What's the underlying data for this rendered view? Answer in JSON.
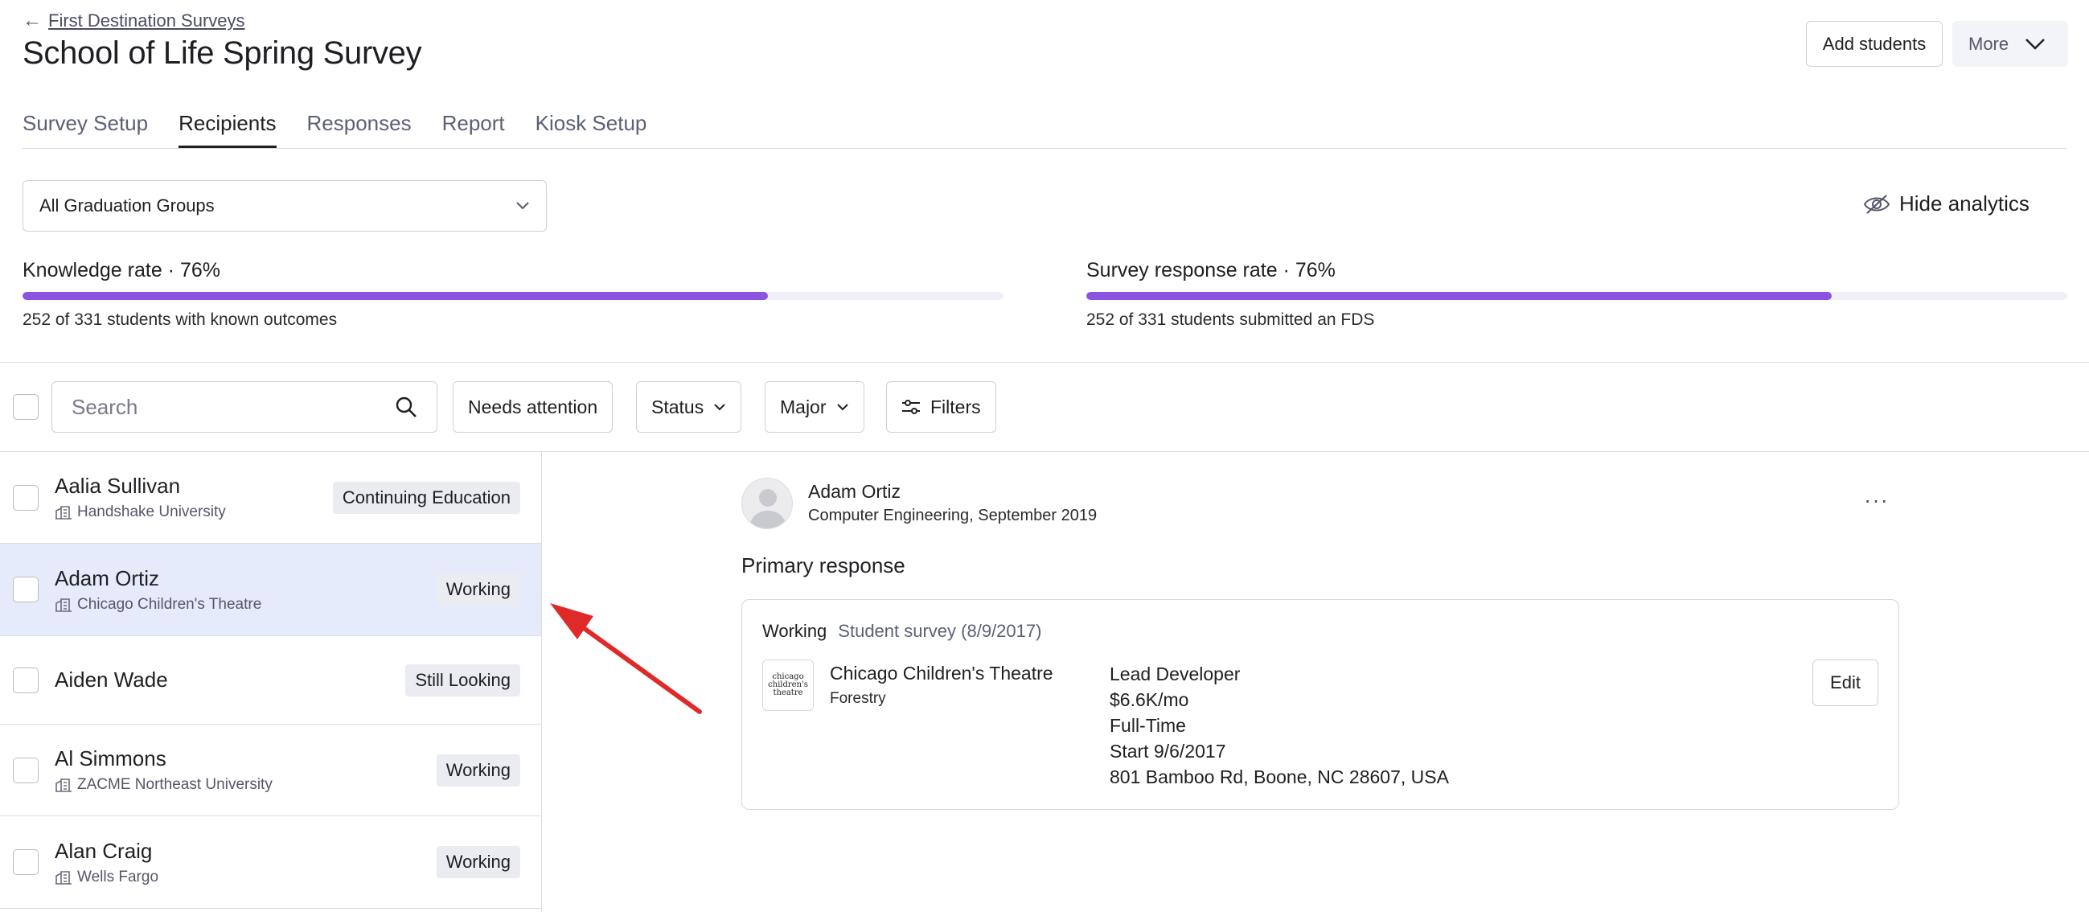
{
  "header": {
    "back_arrow": "←",
    "back_label": "First Destination Surveys",
    "title": "School of Life Spring Survey",
    "add_students_label": "Add students",
    "more_label": "More"
  },
  "tabs": [
    {
      "label": "Survey Setup"
    },
    {
      "label": "Recipients"
    },
    {
      "label": "Responses"
    },
    {
      "label": "Report"
    },
    {
      "label": "Kiosk Setup"
    }
  ],
  "active_tab": "Recipients",
  "group_select": {
    "value": "All Graduation Groups"
  },
  "hide_analytics_label": "Hide analytics",
  "analytics": {
    "knowledge": {
      "title": "Knowledge rate · 76%",
      "percent": 76,
      "subtitle": "252 of 331 students with known outcomes"
    },
    "response": {
      "title": "Survey response rate · 76%",
      "percent": 76,
      "subtitle": "252 of 331 students submitted an FDS"
    }
  },
  "toolbar": {
    "search_placeholder": "Search",
    "needs_attention_label": "Needs attention",
    "status_label": "Status",
    "major_label": "Major",
    "filters_label": "Filters"
  },
  "students": [
    {
      "name": "Aalia Sullivan",
      "org": "Handshake University",
      "status": "Continuing Education",
      "selected": false
    },
    {
      "name": "Adam Ortiz",
      "org": "Chicago Children's Theatre",
      "status": "Working",
      "selected": true
    },
    {
      "name": "Aiden Wade",
      "org": "",
      "status": "Still Looking",
      "selected": false
    },
    {
      "name": "Al Simmons",
      "org": "ZACME Northeast University",
      "status": "Working",
      "selected": false
    },
    {
      "name": "Alan Craig",
      "org": "Wells Fargo",
      "status": "Working",
      "selected": false
    }
  ],
  "detail": {
    "name": "Adam Ortiz",
    "subtitle": "Computer Engineering, September 2019",
    "menu_label": "···",
    "section_title": "Primary response",
    "response": {
      "status": "Working",
      "source": "Student survey (8/9/2017)",
      "logo_text": "chicago children's theatre",
      "company": "Chicago Children's Theatre",
      "field": "Forestry",
      "job_title": "Lead Developer",
      "salary": "$6.6K/mo",
      "employment_type": "Full-Time",
      "start": "Start 9/6/2017",
      "address": "801 Bamboo Rd, Boone, NC 28607, USA",
      "edit_label": "Edit"
    }
  },
  "colors": {
    "accent_purple": "#8b53e0",
    "selected_row": "#e6ebfb",
    "annotation_arrow": "#e02a2a"
  },
  "icons": {
    "back": "arrow-left-icon",
    "more": "chevron-down-icon",
    "hide_analytics": "eye-slash-icon",
    "search": "search-icon",
    "filters": "sliders-icon",
    "org": "building-icon",
    "avatar": "user-placeholder-icon"
  }
}
